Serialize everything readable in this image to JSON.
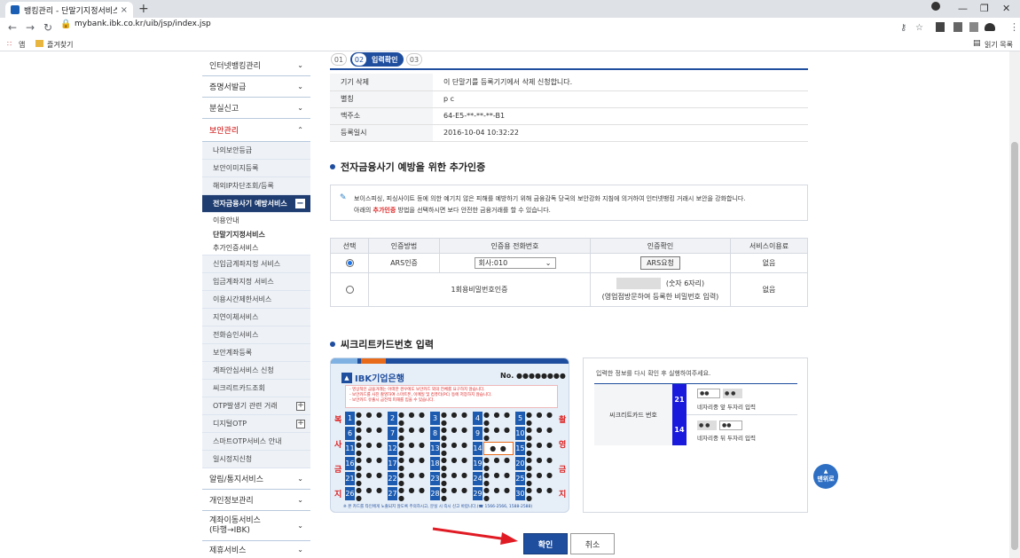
{
  "browser": {
    "tab_title": "뱅킹관리 - 단말기지정서비스 | ",
    "tab_close": "×",
    "new_tab": "+",
    "url": "mybank.ibk.co.kr/uib/jsp/index.jsp",
    "bookmarks": [
      "앱",
      "즐겨찾기"
    ],
    "reading_list": "읽기 목록"
  },
  "sidebar": {
    "top_items": [
      {
        "label": "인터넷뱅킹관리"
      },
      {
        "label": "증명서발급"
      },
      {
        "label": "분실신고"
      }
    ],
    "security": {
      "label": "보안관리",
      "items": [
        "나의보안등급",
        "보안이미지등록",
        "해외IP차단조회/등록"
      ],
      "active": "전자금융사기 예방서비스",
      "active_children": [
        "이용안내",
        "단말기지정서비스",
        "추가인증서비스"
      ],
      "more_items": [
        "신입금계좌지정 서비스",
        "입금계좌지정 서비스",
        "이용시간제한서비스",
        "지연이체서비스",
        "전화승인서비스",
        "보안계좌등록",
        "계좌안심서비스 신청",
        "씨크리트카드조회",
        "OTP발생기 관련 거래",
        "디지털OTP",
        "스마트OTP서비스 안내",
        "일시정지신청"
      ]
    },
    "bottom_items": [
      {
        "label": "알림/통지서비스"
      },
      {
        "label": "개인정보관리"
      },
      {
        "label": "계좌이동서비스\n(타행→IBK)"
      },
      {
        "label": "제휴서비스"
      }
    ]
  },
  "steps": [
    "01",
    "02",
    "입력확인",
    "03"
  ],
  "device_info": [
    {
      "k": "기기 삭제",
      "v": "이 단말기를 등록기기에서 삭제 신청합니다."
    },
    {
      "k": "별칭",
      "v": "p c"
    },
    {
      "k": "맥주소",
      "v": "64-E5-**-**-**-B1"
    },
    {
      "k": "등록일시",
      "v": "2016-10-04 10:32:22"
    }
  ],
  "section_auth_title": "전자금융사기 예방을 위한 추가인증",
  "notice_line1": "보이스피싱, 피싱사이트 등에 의한 예기치 않은 피해를 예방하기 위해 금융감독 당국의 보안강화 지침에 의거하여 인터넷뱅킹 거래시 보안을 강화합니다.",
  "notice_line2_a": "아래의 ",
  "notice_line2_b": "추가인증",
  "notice_line2_c": " 방법을 선택하시면 보다 안전한 금융거래를 할 수 있습니다.",
  "auth_table": {
    "headers": [
      "선택",
      "인증방법",
      "인증용 전화번호",
      "인증확인",
      "서비스이용료"
    ],
    "rows": [
      {
        "method": "ARS인증",
        "phone": "회사:010",
        "confirm": "ARS요청",
        "fee": "없음"
      },
      {
        "method": "1회용비밀번호인증",
        "digits": "(숫자 6자리)",
        "note": "(영업점방문하여 등록한 비밀번호 입력)",
        "fee": "없음"
      }
    ]
  },
  "section_secret_title": "씨크리트카드번호 입력",
  "card": {
    "bank": "IBK기업은행",
    "no_label": "No.",
    "no_value": "●●●●●●●●",
    "warn": [
      "- 영상적인 금융거래는 어떠한 경우에도 보안카드 외의 전체를 요구하지 않습니다.",
      "- 보안카드를 사진 촬영하여 스마트폰, 이메일 및 컴퓨터(PC) 등에 저장하지 않습니다.",
      "- 보안카드 유출시 금전적 피해를 입을 수 있습니다."
    ],
    "left_chars": [
      "복",
      "사",
      "금",
      "지"
    ],
    "right_chars": [
      "촬",
      "영",
      "금",
      "지"
    ],
    "footer": "※ 본 카드를 타인에게 노출되지 않도록 주의하시고, 분실 시 즉시 신고 바랍니다.(☎ 1566-2566, 1588-2588)",
    "dots": "● ● ● ●",
    "cells": [
      [
        1,
        "● ● ● ●",
        2,
        "● ● ● ●",
        3,
        "● ● ● ●",
        4,
        "● ● ● ●",
        5,
        "● ● ● ●"
      ],
      [
        6,
        "● ● ● ●",
        7,
        "● ● ● ●",
        8,
        "● ● ● ●",
        9,
        "● ● ● ●",
        10,
        "● ● ● ●"
      ],
      [
        11,
        "● ● ● ●",
        12,
        "● ● ● ●",
        13,
        "● ● ● ●",
        14,
        "● ●",
        15,
        "● ● ● ●"
      ],
      [
        16,
        "● ● ● ●",
        17,
        "● ● ● ●",
        18,
        "● ● ● ●",
        19,
        "● ● ● ●",
        20,
        "● ● ● ●"
      ],
      [
        21,
        "● ● ● ●",
        22,
        "● ● ● ●",
        23,
        "● ● ● ●",
        24,
        "● ● ● ●",
        25,
        "● ● ● ●"
      ],
      [
        26,
        "● ● ● ●",
        27,
        "● ● ● ●",
        28,
        "● ● ● ●",
        29,
        "● ● ● ●",
        30,
        "● ● ● ●"
      ]
    ]
  },
  "card_panel": {
    "title": "입력한 정보를 다시 확인 후 실행하여주세요.",
    "label": "씨크리트카드 번호",
    "rows": [
      {
        "num": "21",
        "a": "●●",
        "b": "● ●",
        "hint": "네자리중 앞 두자리 입력"
      },
      {
        "num": "14",
        "a": "● ●",
        "b": "●●",
        "hint": "네자리중 뒤 두자리 입력"
      }
    ]
  },
  "confirm_label": "확인",
  "cancel_label": "취소",
  "top_button_label": "맨위로"
}
